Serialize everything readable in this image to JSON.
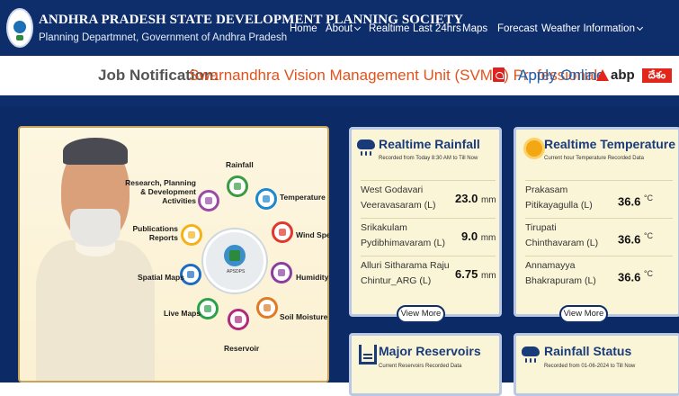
{
  "header": {
    "title": "ANDHRA PRADESH STATE DEVELOPMENT PLANNING SOCIETY",
    "subtitle": "Planning Departmnet, Government of Andhra Pradesh",
    "nav": [
      {
        "label": "Home"
      },
      {
        "label": "About"
      },
      {
        "label": "Realtime"
      },
      {
        "label": "Last 24hrs"
      },
      {
        "label": "Maps"
      },
      {
        "label": "Forecast"
      },
      {
        "label": "Weather Information"
      }
    ]
  },
  "notification": {
    "label": "Job Notification:",
    "text": "Swarnandhra Vision Management Unit (SVMU) Professionals",
    "apply": "Apply Online"
  },
  "watermark": {
    "brand": "abp",
    "brand_script": "దేశం"
  },
  "hero": {
    "center_caption": "APSDPS",
    "items": [
      {
        "label": "Rainfall",
        "icon": "rain-cloud-icon",
        "color": "#3a9b43"
      },
      {
        "label": "Temperature",
        "icon": "thermometer-icon",
        "color": "#1b88d0"
      },
      {
        "label": "Wind Speed",
        "icon": "windsock-icon",
        "color": "#e0382c"
      },
      {
        "label": "Humidity",
        "icon": "humidity-icon",
        "color": "#8a3fa0"
      },
      {
        "label": "Soil Moisture",
        "icon": "soil-icon",
        "color": "#e07a25"
      },
      {
        "label": "Reservoir",
        "icon": "reservoir-icon",
        "color": "#b12a7a"
      },
      {
        "label": "Live Maps",
        "icon": "map-icon",
        "color": "#2ba24a"
      },
      {
        "label": "Spatial Maps",
        "icon": "layers-icon",
        "color": "#1d6cc0"
      },
      {
        "label": "Publications Reports",
        "icon": "report-icon",
        "color": "#f2b319"
      },
      {
        "label": "Research, Planning & Development Activities",
        "icon": "research-icon",
        "color": "#9a4aa6"
      }
    ]
  },
  "rainfall": {
    "title": "Realtime Rainfall",
    "subtitle": "Recorded from Today 8:30 AM to Till Now",
    "rows": [
      {
        "district": "West Godavari",
        "place": "Veeravasaram (L)",
        "value": "23.0",
        "unit": "mm"
      },
      {
        "district": "Srikakulam",
        "place": "Pydibhimavaram (L)",
        "value": "9.0",
        "unit": "mm"
      },
      {
        "district": "Alluri Sitharama Raju",
        "place": "Chintur_ARG (L)",
        "value": "6.75",
        "unit": "mm"
      }
    ],
    "view_more": "View More"
  },
  "temperature": {
    "title": "Realtime Temperature",
    "subtitle": "Current hour Temperature Recorded Data",
    "rows": [
      {
        "district": "Prakasam",
        "place": "Pitikayagulla (L)",
        "value": "36.6",
        "unit": "°C"
      },
      {
        "district": "Tirupati",
        "place": "Chinthavaram (L)",
        "value": "36.6",
        "unit": "°C"
      },
      {
        "district": "Annamayya",
        "place": "Bhakrapuram (L)",
        "value": "36.6",
        "unit": "°C"
      }
    ],
    "view_more": "View More"
  },
  "reservoirs": {
    "title": "Major Reservoirs",
    "subtitle": "Current Reservoirs Recorded Data"
  },
  "rainfall_status": {
    "title": "Rainfall Status",
    "subtitle": "Recorded from 01-06-2024 to Till Now"
  }
}
